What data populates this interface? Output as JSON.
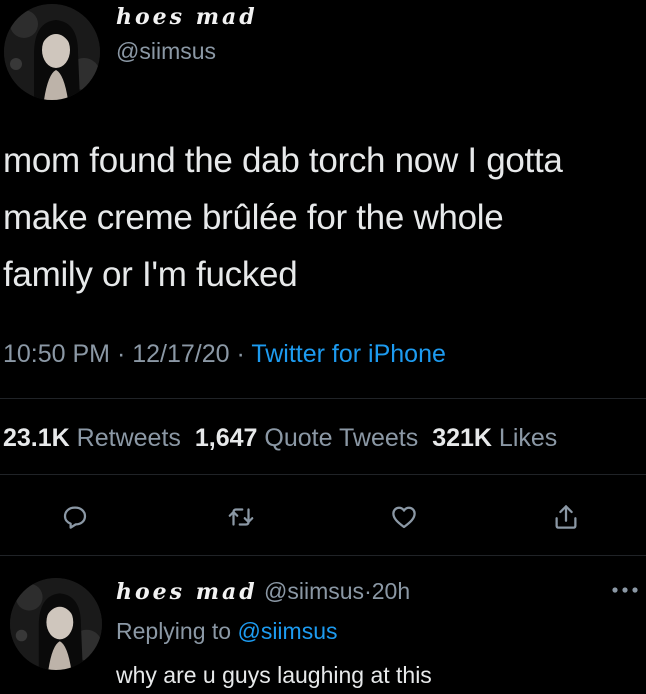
{
  "tweet": {
    "display_name": "hoes mad",
    "handle": "@siimsus",
    "text_lines": [
      "mom found the dab torch now I gotta",
      "make creme brûlée for the whole",
      "family or I'm fucked"
    ],
    "time": "10:50 PM",
    "date": "12/17/20",
    "separator": "·",
    "source": "Twitter for iPhone"
  },
  "stats": {
    "retweets_count": "23.1K",
    "retweets_label": "Retweets",
    "quotes_count": "1,647",
    "quotes_label": "Quote Tweets",
    "likes_count": "321K",
    "likes_label": "Likes"
  },
  "actions": {
    "reply_icon": "reply-icon",
    "retweet_icon": "retweet-icon",
    "like_icon": "heart-icon",
    "share_icon": "share-icon"
  },
  "reply": {
    "display_name": "hoes mad",
    "handle": "@siimsus",
    "separator": "·",
    "time": "20h",
    "replying_prefix": "Replying to",
    "replying_mention": "@siimsus",
    "text": "why are u guys laughing at this"
  },
  "colors": {
    "background": "#000000",
    "text": "#e7e9ea",
    "muted": "#8b98a5",
    "accent": "#1d9bf0"
  }
}
